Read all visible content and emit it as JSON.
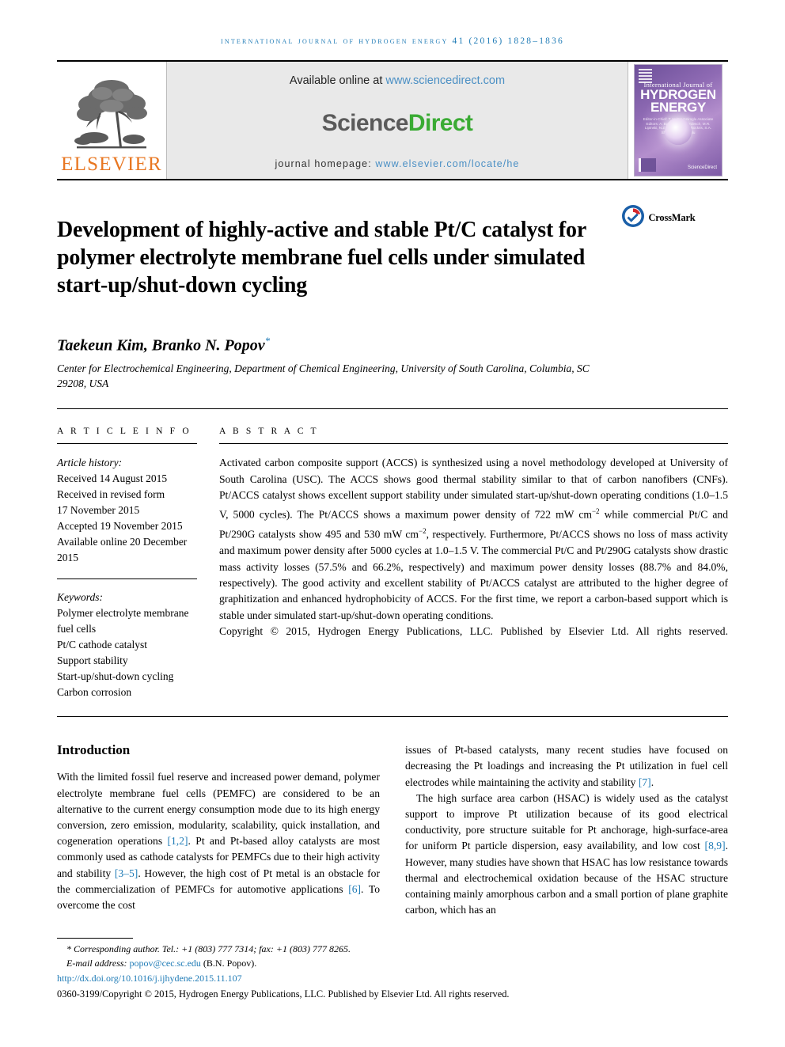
{
  "running_head": "international journal of hydrogen energy 41 (2016) 1828–1836",
  "masthead": {
    "publisher_name": "ELSEVIER",
    "available_prefix": "Available online at ",
    "available_url": "www.sciencedirect.com",
    "sciencedirect_part1": "Science",
    "sciencedirect_part2": "Direct",
    "journal_home_label": "journal homepage: ",
    "journal_home_url": "www.elsevier.com/locate/he",
    "cover": {
      "line_small": "International Journal of",
      "line_big_1": "HYDROGEN",
      "line_big_2": "ENERGY",
      "editors": "Editor-in-Chief: T. Nejat Veziroglu   Associate Editors: A. Bartels, E.C. Kordesch, M.R. Lipinski, N.Z. Muradov, J.M. Bockris, S.A. Sherif, T.N. Veziroglu",
      "sciencedirect_mark": "ScienceDirect"
    }
  },
  "article": {
    "title": "Development of highly-active and stable Pt/C catalyst for polymer electrolyte membrane fuel cells under simulated start-up/shut-down cycling",
    "crossmark_label": "CrossMark",
    "authors": "Taekeun Kim, Branko N. Popov",
    "author_star": "*",
    "affiliation": "Center for Electrochemical Engineering, Department of Chemical Engineering, University of South Carolina, Columbia, SC 29208, USA"
  },
  "article_info": {
    "kicker": "A R T I C L E    I N F O",
    "history_label": "Article history:",
    "history": [
      "Received 14 August 2015",
      "Received in revised form",
      "17 November 2015",
      "Accepted 19 November 2015",
      "Available online 20 December 2015"
    ],
    "keywords_label": "Keywords:",
    "keywords": [
      "Polymer electrolyte membrane fuel cells",
      "Pt/C cathode catalyst",
      "Support stability",
      "Start-up/shut-down cycling",
      "Carbon corrosion"
    ]
  },
  "abstract": {
    "kicker": "A B S T R A C T",
    "body_part1": "Activated carbon composite support (ACCS) is synthesized using a novel methodology developed at University of South Carolina (USC). The ACCS shows good thermal stability similar to that of carbon nanofibers (CNFs). Pt/ACCS catalyst shows excellent support stability under simulated start-up/shut-down operating conditions (1.0–1.5 V, 5000 cycles). The Pt/ACCS shows a maximum power density of 722 mW cm",
    "sup1": "−2",
    "body_part2": " while commercial Pt/C and Pt/290G catalysts show 495 and 530 mW cm",
    "sup2": "−2",
    "body_part3": ", respectively. Furthermore, Pt/ACCS shows no loss of mass activity and maximum power density after 5000 cycles at 1.0–1.5 V. The commercial Pt/C and Pt/290G catalysts show drastic mass activity losses (57.5% and 66.2%, respectively) and maximum power density losses (88.7% and 84.0%, respectively). The good activity and excellent stability of Pt/ACCS catalyst are attributed to the higher degree of graphitization and enhanced hydrophobicity of ACCS. For the first time, we report a carbon-based support which is stable under simulated start-up/shut-down operating conditions.",
    "copyright": "Copyright © 2015, Hydrogen Energy Publications, LLC. Published by Elsevier Ltd. All rights reserved."
  },
  "introduction": {
    "heading": "Introduction",
    "left_col": {
      "p1_a": "With the limited fossil fuel reserve and increased power demand, polymer electrolyte membrane fuel cells (PEMFC) are considered to be an alternative to the current energy consumption mode due to its high energy conversion, zero emission, modularity, scalability, quick installation, and cogeneration operations ",
      "cite1": "[1,2]",
      "p1_b": ". Pt and Pt-based alloy catalysts are most commonly used as cathode catalysts for PEMFCs due to their high activity and stability ",
      "cite2": "[3–5]",
      "p1_c": ". However, the high cost of Pt metal is an obstacle for the commercialization of PEMFCs for automotive applications ",
      "cite3": "[6]",
      "p1_d": ". To overcome the cost"
    },
    "right_col": {
      "p1_a": "issues of Pt-based catalysts, many recent studies have focused on decreasing the Pt loadings and increasing the Pt utilization in fuel cell electrodes while maintaining the activity and stability ",
      "cite4": "[7]",
      "p1_b": ".",
      "p2_a": "The high surface area carbon (HSAC) is widely used as the catalyst support to improve Pt utilization because of its good electrical conductivity, pore structure suitable for Pt anchorage, high-surface-area for uniform Pt particle dispersion, easy availability, and low cost ",
      "cite5": "[8,9]",
      "p2_b": ". However, many studies have shown that HSAC has low resistance towards thermal and electrochemical oxidation because of the HSAC structure containing mainly amorphous carbon and a small portion of plane graphite carbon, which has an"
    }
  },
  "footnote": {
    "corresponding_star": "*",
    "corresponding": " Corresponding author. Tel.: +1 (803) 777 7314; fax: +1 (803) 777 8265.",
    "email_label": "E-mail address: ",
    "email": "popov@cec.sc.edu",
    "email_suffix": " (B.N. Popov).",
    "doi": "http://dx.doi.org/10.1016/j.ijhydene.2015.11.107",
    "issn_copyright": "0360-3199/Copyright © 2015, Hydrogen Energy Publications, LLC. Published by Elsevier Ltd. All rights reserved."
  },
  "colors": {
    "link_blue": "#1f7bb6",
    "elsevier_orange": "#E87722",
    "sciencedirect_green": "#3aab34",
    "cover_purple": "#7d5aa6"
  }
}
